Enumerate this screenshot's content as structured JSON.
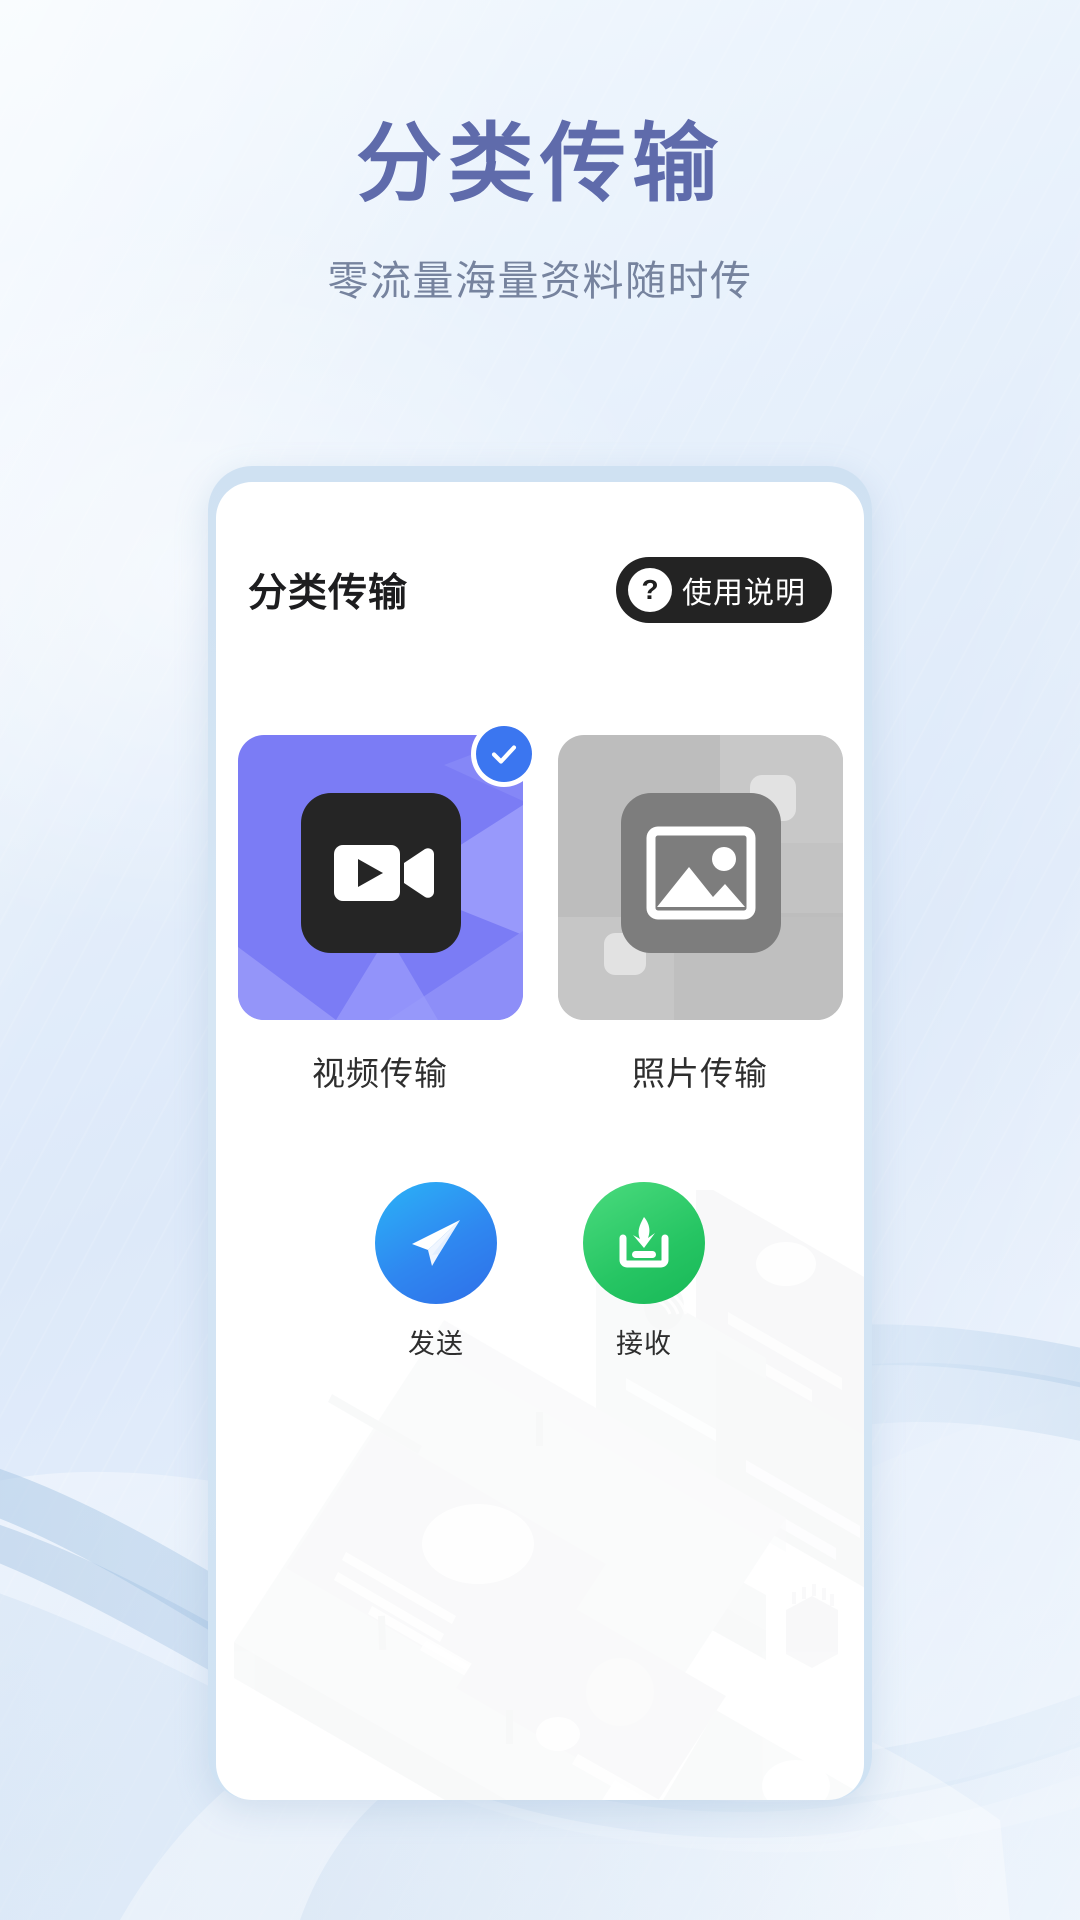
{
  "hero": {
    "title": "分类传输",
    "subtitle": "零流量海量资料随时传",
    "title_color": "#5f6bab",
    "subtitle_color": "#76839e"
  },
  "card": {
    "title": "分类传输",
    "help_button": {
      "icon": "question-mark-icon",
      "icon_glyph": "?",
      "label": "使用说明",
      "background_color": "#232323"
    }
  },
  "tiles": [
    {
      "id": "video",
      "label": "视频传输",
      "icon": "video-camera-icon",
      "selected": true,
      "selected_badge": "check-icon",
      "badge_color": "#3b76f0",
      "art_color": "#7b7cf5",
      "art_color_light": "#9a9bfb",
      "icon_tile_color": "#252525"
    },
    {
      "id": "photo",
      "label": "照片传输",
      "icon": "image-icon",
      "selected": false,
      "art_color": "#bdbdbd",
      "art_color_light": "#cfcfcf",
      "icon_tile_color": "#7d7d7d"
    }
  ],
  "actions": [
    {
      "id": "send",
      "label": "发送",
      "icon": "paper-plane-icon",
      "color": "#2f87f0"
    },
    {
      "id": "receive",
      "label": "接收",
      "icon": "download-tray-icon",
      "color": "#26c563"
    }
  ]
}
